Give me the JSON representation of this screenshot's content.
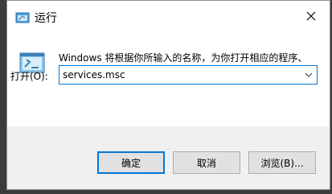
{
  "window": {
    "title": "运行",
    "close_icon": "close-icon"
  },
  "dialog": {
    "description": "Windows 将根据你所输入的名称，为你打开相应的程序、文件夹、文档或 Internet 资源。",
    "open_label": "打开(O):",
    "input_value": "services.msc"
  },
  "buttons": {
    "ok": "确定",
    "cancel": "取消",
    "browse": "浏览(B)..."
  },
  "colors": {
    "accent": "#0078d7",
    "desktop": "#3b3b3b"
  }
}
